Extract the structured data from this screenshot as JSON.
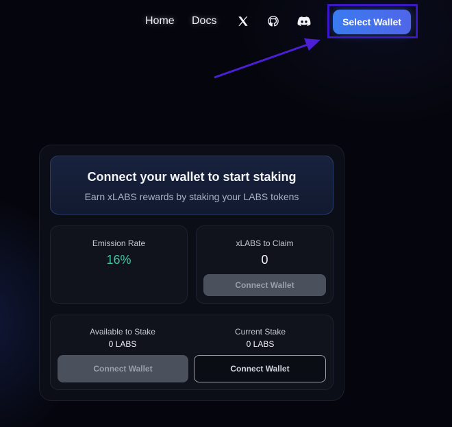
{
  "nav": {
    "home": "Home",
    "docs": "Docs",
    "icons": [
      "x-twitter-icon",
      "github-icon",
      "discord-icon"
    ],
    "select_wallet": "Select Wallet"
  },
  "hero": {
    "title": "Connect your wallet to start staking",
    "subtitle": "Earn xLABS rewards by staking your LABS tokens"
  },
  "emission": {
    "label": "Emission Rate",
    "value": "16%"
  },
  "claim": {
    "label": "xLABS to Claim",
    "value": "0",
    "button": "Connect Wallet"
  },
  "available": {
    "label": "Available to Stake",
    "value": "0 LABS",
    "button": "Connect Wallet"
  },
  "current": {
    "label": "Current Stake",
    "value": "0 LABS",
    "button": "Connect Wallet"
  },
  "colors": {
    "accent": "#3a7bf0",
    "highlight": "#3a17c9",
    "emission_green": "#3ec7a0",
    "background": "#05060d"
  }
}
